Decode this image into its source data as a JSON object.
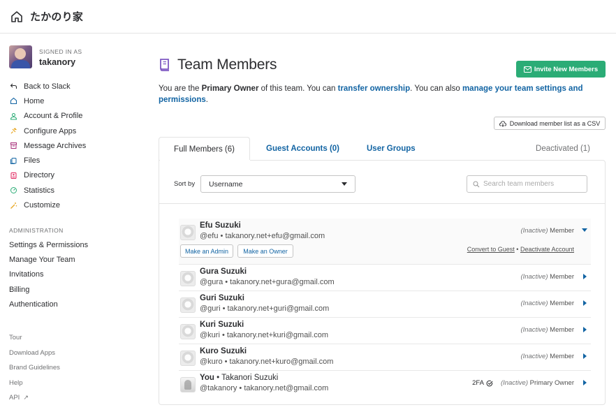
{
  "team": {
    "name": "たかのり家"
  },
  "user": {
    "signed_in_label": "SIGNED IN AS",
    "name": "takanory"
  },
  "nav": [
    {
      "label": "Back to Slack",
      "icon": "back-arrow-icon",
      "color": "#2c2d30"
    },
    {
      "label": "Home",
      "icon": "home-icon",
      "color": "#1264a3"
    },
    {
      "label": "Account & Profile",
      "icon": "person-icon",
      "color": "#2bac76"
    },
    {
      "label": "Configure Apps",
      "icon": "plug-icon",
      "color": "#e8a723"
    },
    {
      "label": "Message Archives",
      "icon": "archive-icon",
      "color": "#a72f79"
    },
    {
      "label": "Files",
      "icon": "files-icon",
      "color": "#1264a3"
    },
    {
      "label": "Directory",
      "icon": "directory-icon",
      "color": "#e01e5a"
    },
    {
      "label": "Statistics",
      "icon": "gauge-icon",
      "color": "#2bac76"
    },
    {
      "label": "Customize",
      "icon": "wand-icon",
      "color": "#e8a723"
    }
  ],
  "admin": {
    "heading": "ADMINISTRATION",
    "items": [
      "Settings & Permissions",
      "Manage Your Team",
      "Invitations",
      "Billing",
      "Authentication"
    ]
  },
  "misc": [
    {
      "label": "Tour"
    },
    {
      "label": "Download Apps"
    },
    {
      "label": "Brand Guidelines"
    },
    {
      "label": "Help"
    },
    {
      "label": "API",
      "external": "↗"
    }
  ],
  "page": {
    "title": "Team Members",
    "invite_label": "Invite New Members",
    "desc_1": "You are the ",
    "desc_owner": "Primary Owner",
    "desc_2": " of this team. You can ",
    "desc_link1": "transfer ownership",
    "desc_3": ". You can also ",
    "desc_link2": "manage your team settings and permissions",
    "desc_4": ".",
    "csv_label": "Download member list as a CSV"
  },
  "tabs": {
    "full": "Full Members (6)",
    "guest": "Guest Accounts (0)",
    "groups": "User Groups",
    "deactivated": "Deactivated (1)"
  },
  "sort": {
    "label": "Sort by",
    "value": "Username"
  },
  "search": {
    "placeholder": "Search team members"
  },
  "members": [
    {
      "name": "Efu Suzuki",
      "handle": "@efu",
      "email": "takanory.net+efu@gmail.com",
      "status": "(Inactive)",
      "role": "Member"
    },
    {
      "name": "Gura Suzuki",
      "handle": "@gura",
      "email": "takanory.net+gura@gmail.com",
      "status": "(Inactive)",
      "role": "Member"
    },
    {
      "name": "Guri Suzuki",
      "handle": "@guri",
      "email": "takanory.net+guri@gmail.com",
      "status": "(Inactive)",
      "role": "Member"
    },
    {
      "name": "Kuri Suzuki",
      "handle": "@kuri",
      "email": "takanory.net+kuri@gmail.com",
      "status": "(Inactive)",
      "role": "Member"
    },
    {
      "name": "Kuro Suzuki",
      "handle": "@kuro",
      "email": "takanory.net+kuro@gmail.com",
      "status": "(Inactive)",
      "role": "Member"
    },
    {
      "name": "You",
      "fullname": "Takanori Suzuki",
      "handle": "@takanory",
      "email": "takanory.net@gmail.com",
      "status": "(Inactive)",
      "role": "Primary Owner",
      "twofa": "2FA"
    }
  ],
  "expanded_actions": {
    "make_admin": "Make an Admin",
    "make_owner": "Make an Owner",
    "convert": "Convert to Guest",
    "deactivate": "Deactivate Account"
  },
  "colors": {
    "link": "#1264a3",
    "accent_green": "#2bac76",
    "title_icon": "#7e57c2"
  }
}
